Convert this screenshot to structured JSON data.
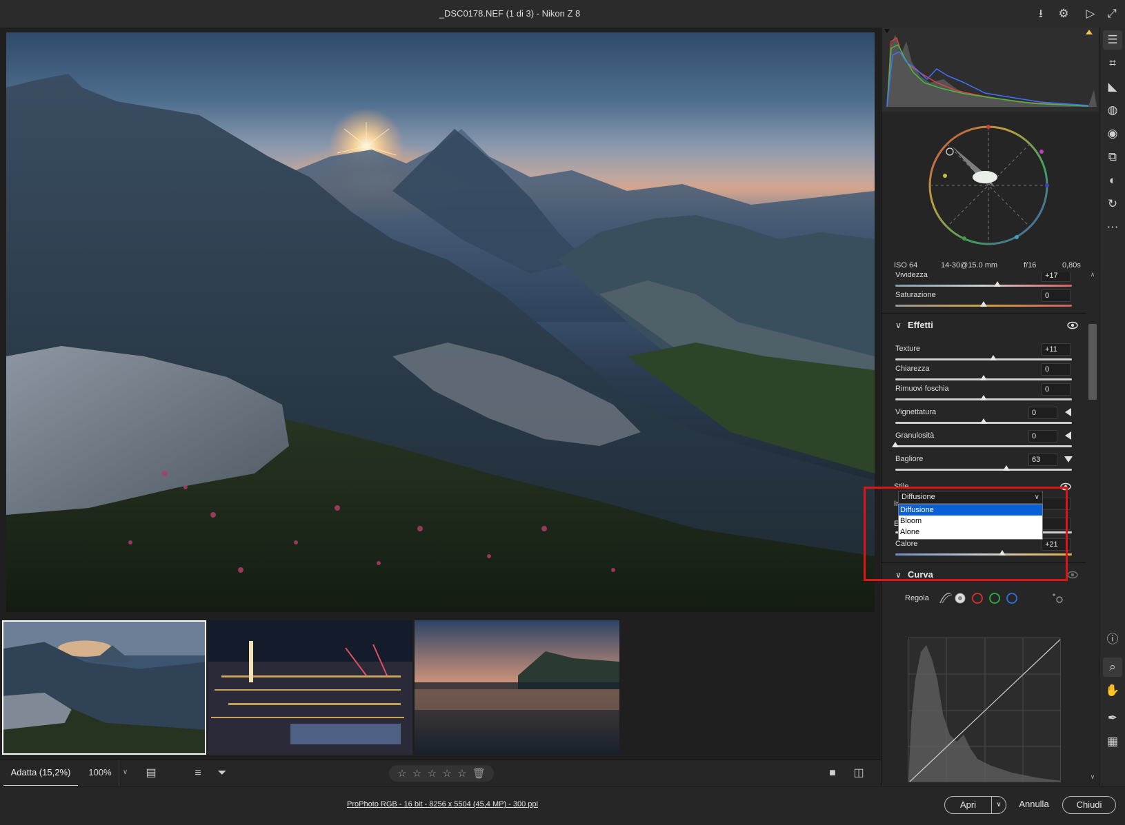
{
  "window": {
    "title": "_DSC0178.NEF (1 di 3)  -  Nikon Z 8"
  },
  "exif": {
    "iso": "ISO 64",
    "lens": "14-30@15.0 mm",
    "aperture": "f/16",
    "shutter": "0,80s"
  },
  "color_panel": {
    "sliders": [
      {
        "label": "Vividezza",
        "value": "+17",
        "position": 0.58
      },
      {
        "label": "Saturazione",
        "value": "0",
        "position": 0.5
      }
    ]
  },
  "effects": {
    "title": "Effetti",
    "sliders": [
      {
        "label": "Texture",
        "value": "+11",
        "position": 0.555
      },
      {
        "label": "Chiarezza",
        "value": "0",
        "position": 0.5
      },
      {
        "label": "Rimuovi foschia",
        "value": "0",
        "position": 0.5
      },
      {
        "label": "Vignettatura",
        "value": "0",
        "position": 0.5
      },
      {
        "label": "Granulosità",
        "value": "0",
        "position": 0.0
      },
      {
        "label": "Bagliore",
        "value": "63",
        "position": 0.63
      }
    ],
    "glow": {
      "style_label": "Stile",
      "style_value": "Diffusione",
      "options": [
        "Diffusione",
        "Bloom",
        "Alone"
      ],
      "intensity_label": "Inten",
      "extent_label": "Esten",
      "warmth": {
        "label": "Calore",
        "value": "+21",
        "position": 0.605
      }
    }
  },
  "curve": {
    "title": "Curva",
    "adjust_label": "Regola"
  },
  "bottom": {
    "zoom_fit": "Adatta (15,2%)",
    "zoom_100": "100%",
    "stars": [
      "☆",
      "☆",
      "☆",
      "☆",
      "☆"
    ]
  },
  "status": {
    "workflow": "ProPhoto RGB - 16 bit - 8256 x 5504 (45,4 MP) - 300 ppi",
    "open_label": "Apri",
    "cancel_label": "Annulla",
    "close_label": "Chiudi"
  },
  "colors": {
    "accent_red": "#e01414",
    "selection_blue": "#0a5fd6"
  }
}
